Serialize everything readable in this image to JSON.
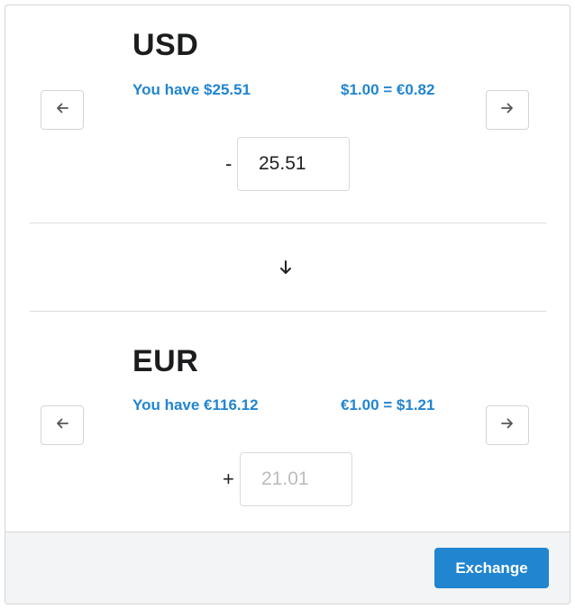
{
  "from": {
    "currency": "USD",
    "balance": "You have $25.51",
    "rate": "$1.00 = €0.82",
    "sign": "-",
    "amount": "25.51",
    "prev_icon": "arrow-left-icon",
    "next_icon": "arrow-right-icon"
  },
  "swap_icon": "arrow-down-icon",
  "to": {
    "currency": "EUR",
    "balance": "You have €116.12",
    "rate": "€1.00 = $1.21",
    "sign": "+",
    "placeholder": "21.01",
    "prev_icon": "arrow-left-icon",
    "next_icon": "arrow-right-icon"
  },
  "footer": {
    "exchange_label": "Exchange"
  },
  "colors": {
    "accent": "#2185d0",
    "footer_bg": "#f3f4f5"
  }
}
